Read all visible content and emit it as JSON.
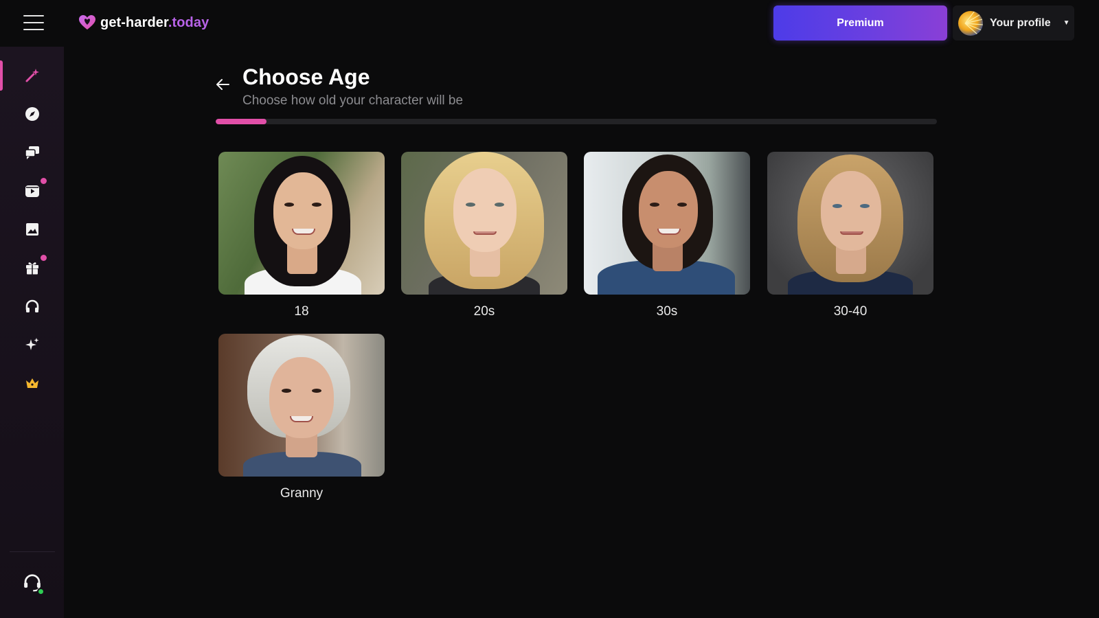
{
  "header": {
    "logo_main": "get-harder",
    "logo_accent": ".today",
    "premium_label": "Premium",
    "profile_label": "Your profile"
  },
  "sidebar": {
    "items": [
      {
        "icon": "magic-wand-icon",
        "active": true
      },
      {
        "icon": "compass-icon"
      },
      {
        "icon": "chat-bubbles-icon"
      },
      {
        "icon": "video-icon",
        "badge": true
      },
      {
        "icon": "image-icon"
      },
      {
        "icon": "gift-icon",
        "badge": true
      },
      {
        "icon": "headphones-icon"
      },
      {
        "icon": "sparkles-icon"
      },
      {
        "icon": "crown-icon"
      }
    ],
    "support_icon": "headset-icon"
  },
  "page": {
    "title": "Choose Age",
    "subtitle": "Choose how old your character will be",
    "progress": 0.07
  },
  "options": [
    {
      "label": "18"
    },
    {
      "label": "20s"
    },
    {
      "label": "30s"
    },
    {
      "label": "30-40"
    },
    {
      "label": "Granny"
    }
  ],
  "colors": {
    "accent": "#e14fa8",
    "brand_purple": "#b863e8",
    "premium_start": "#4d3ce8",
    "online": "#2ecc54"
  }
}
